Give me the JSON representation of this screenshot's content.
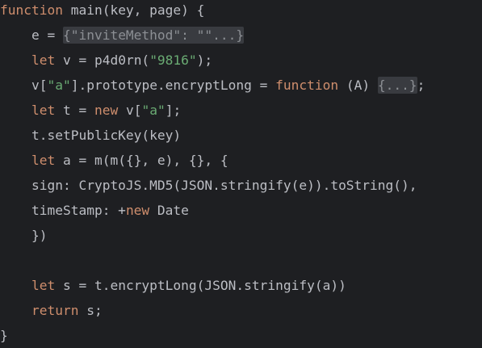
{
  "editor": {
    "lines": [
      [
        [
          "kw",
          "function"
        ],
        [
          "txt",
          " main(key, page) {"
        ]
      ],
      [
        [
          "txt",
          "    e = "
        ],
        [
          "fold",
          "{\"inviteMethod\": \"\"...}"
        ]
      ],
      [
        [
          "txt",
          "    "
        ],
        [
          "kw",
          "let"
        ],
        [
          "txt",
          " v = p4d0rn("
        ],
        [
          "str",
          "\"9816\""
        ],
        [
          "txt",
          ");"
        ]
      ],
      [
        [
          "txt",
          "    v["
        ],
        [
          "str",
          "\"a\""
        ],
        [
          "txt",
          "].prototype.encryptLong = "
        ],
        [
          "kw",
          "function"
        ],
        [
          "txt",
          " (A) "
        ],
        [
          "fold",
          "{...}"
        ],
        [
          "txt",
          ";"
        ]
      ],
      [
        [
          "txt",
          "    "
        ],
        [
          "kw",
          "let"
        ],
        [
          "txt",
          " t = "
        ],
        [
          "kw",
          "new"
        ],
        [
          "txt",
          " v["
        ],
        [
          "str",
          "\"a\""
        ],
        [
          "txt",
          "];"
        ]
      ],
      [
        [
          "txt",
          "    t.setPublicKey(key)"
        ]
      ],
      [
        [
          "txt",
          "    "
        ],
        [
          "kw",
          "let"
        ],
        [
          "txt",
          " a = m(m({}, e), {}, {"
        ]
      ],
      [
        [
          "txt",
          "    sign: CryptoJS.MD5(JSON.stringify(e)).toString(),"
        ]
      ],
      [
        [
          "txt",
          "    timeStamp: +"
        ],
        [
          "kw",
          "new"
        ],
        [
          "txt",
          " Date"
        ]
      ],
      [
        [
          "txt",
          "    })"
        ]
      ],
      [
        [
          "txt",
          ""
        ]
      ],
      [
        [
          "txt",
          "    "
        ],
        [
          "kw",
          "let"
        ],
        [
          "txt",
          " s = t.encryptLong(JSON.stringify(a))"
        ]
      ],
      [
        [
          "txt",
          "    "
        ],
        [
          "kw",
          "return"
        ],
        [
          "txt",
          " s;"
        ]
      ],
      [
        [
          "txt",
          "}"
        ]
      ]
    ]
  }
}
